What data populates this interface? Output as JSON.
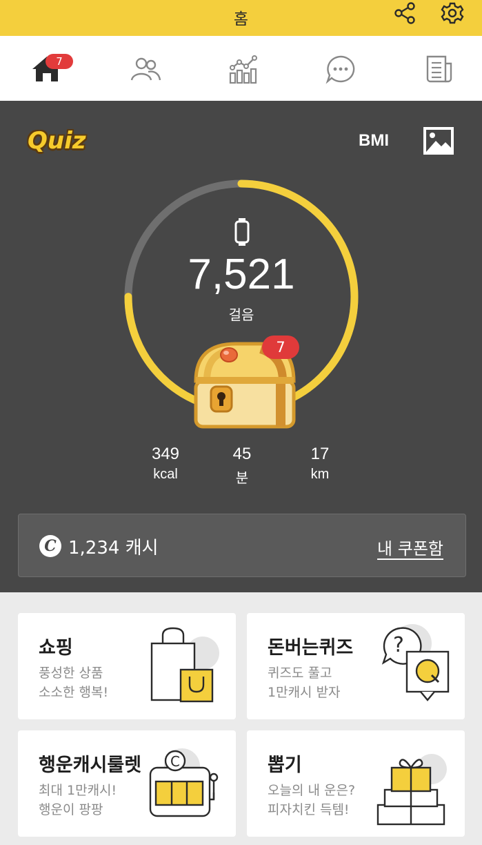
{
  "header": {
    "title": "홈",
    "share_icon": "share-icon",
    "settings_icon": "gear-icon",
    "bg_color": "#f4cf3d"
  },
  "nav": {
    "tabs": [
      {
        "icon": "home-icon",
        "active": true
      },
      {
        "icon": "friends-icon"
      },
      {
        "icon": "ranking-icon"
      },
      {
        "icon": "chat-icon"
      },
      {
        "icon": "news-icon"
      }
    ],
    "home_badge": "7"
  },
  "hero": {
    "quiz_logo": "Quiz",
    "bmi_label": "BMI",
    "image_icon": "image-icon",
    "steps": "7,521",
    "steps_label": "걸음",
    "step_progress": 0.75,
    "chest_badge": "7",
    "stats": [
      {
        "value": "349",
        "unit": "kcal"
      },
      {
        "value": "45",
        "unit": "분"
      },
      {
        "value": "17",
        "unit": "km"
      }
    ],
    "cash_symbol": "C",
    "cash": "1,234 캐시",
    "coupon_link": "내 쿠폰함",
    "accent_color": "#f4cf3d"
  },
  "cards": [
    {
      "title": "쇼핑",
      "line1": "풍성한 상품",
      "line2": "소소한 행복!",
      "icon": "shopping-bag-icon"
    },
    {
      "title": "돈버는퀴즈",
      "line1": "퀴즈도 풀고",
      "line2": "1만캐시 받자",
      "icon": "quiz-question-icon"
    },
    {
      "title": "행운캐시룰렛",
      "line1": "최대 1만캐시!",
      "line2": "행운이 팡팡",
      "icon": "slot-machine-icon"
    },
    {
      "title": "뽑기",
      "line1": "오늘의 내 운은?",
      "line2": "피자치킨 득템!",
      "icon": "gift-boxes-icon"
    }
  ]
}
